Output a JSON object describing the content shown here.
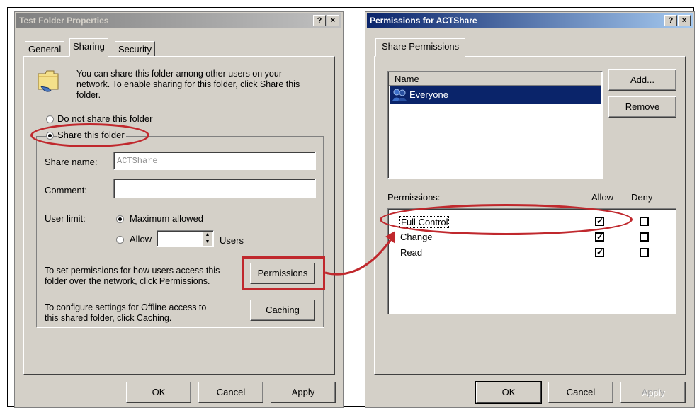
{
  "left_dialog": {
    "title": "Test Folder Properties",
    "help": "?",
    "close": "×",
    "tabs": [
      "General",
      "Sharing",
      "Security"
    ],
    "description": [
      "You can share this folder among other users on your",
      "network.  To enable sharing for this folder, click Share this",
      "folder."
    ],
    "radio_no_share": "Do not share this folder",
    "radio_share": "Share this folder",
    "share_name_label": "Share name:",
    "share_name_value": "ACTShare",
    "comment_label": "Comment:",
    "comment_value": "",
    "user_limit_label": "User limit:",
    "max_allowed": "Maximum allowed",
    "allow": "Allow",
    "users": "Users",
    "perm_text": [
      "To set permissions for how users access this",
      "folder over the network, click Permissions."
    ],
    "permissions_button": "Permissions",
    "cache_text": [
      "To configure settings for Offline access to",
      "this shared folder, click Caching."
    ],
    "caching_button": "Caching",
    "ok": "OK",
    "cancel": "Cancel",
    "apply": "Apply"
  },
  "right_dialog": {
    "title": "Permissions for ACTShare",
    "help": "?",
    "close": "×",
    "tab": "Share Permissions",
    "name_header": "Name",
    "names": [
      "Everyone"
    ],
    "add_button": "Add...",
    "remove_button": "Remove",
    "permissions_label": "Permissions:",
    "allow_header": "Allow",
    "deny_header": "Deny",
    "permissions": [
      {
        "name": "Full Control",
        "allow": true,
        "deny": false
      },
      {
        "name": "Change",
        "allow": true,
        "deny": false
      },
      {
        "name": "Read",
        "allow": true,
        "deny": false
      }
    ],
    "ok": "OK",
    "cancel": "Cancel",
    "apply": "Apply"
  },
  "annotation_color": "#c0282d"
}
